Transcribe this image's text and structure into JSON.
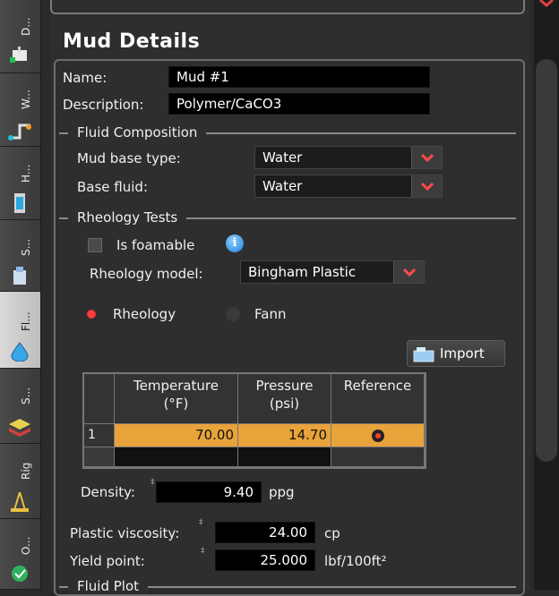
{
  "tabs": [
    {
      "label": "D...",
      "icon": "equipment-icon"
    },
    {
      "label": "W...",
      "icon": "wellbore-icon"
    },
    {
      "label": "H...",
      "icon": "hole-section-icon"
    },
    {
      "label": "S...",
      "icon": "string-icon"
    },
    {
      "label": "Fl...",
      "icon": "fluid-drop-icon"
    },
    {
      "label": "S...",
      "icon": "survey-icon"
    },
    {
      "label": "Rig",
      "icon": "rig-icon"
    },
    {
      "label": "O...",
      "icon": "operations-icon"
    }
  ],
  "title": "Mud Details",
  "name": {
    "label": "Name:",
    "value": "Mud #1"
  },
  "description": {
    "label": "Description:",
    "value": "Polymer/CaCO3"
  },
  "fluid_composition": {
    "title": "Fluid Composition",
    "mud_base_type": {
      "label": "Mud base type:",
      "value": "Water"
    },
    "base_fluid": {
      "label": "Base fluid:",
      "value": "Water"
    }
  },
  "rheology_tests": {
    "title": "Rheology Tests",
    "is_foamable": {
      "label": "Is foamable",
      "checked": false
    },
    "rheology_model": {
      "label": "Rheology model:",
      "value": "Bingham Plastic"
    },
    "radio_rheology": {
      "label": "Rheology",
      "selected": true
    },
    "radio_fann": {
      "label": "Fann",
      "selected": false
    },
    "import_label": "Import",
    "table": {
      "headers": [
        "Temperature (°F)",
        "Pressure (psi)",
        "Reference"
      ],
      "header_lines": [
        [
          "Temperature",
          "(°F)"
        ],
        [
          "Pressure",
          "(psi)"
        ],
        [
          "Reference"
        ]
      ],
      "rows": [
        {
          "index": "1",
          "temperature": "70.00",
          "pressure": "14.70",
          "reference": true
        }
      ]
    }
  },
  "density": {
    "label": "Density:",
    "value": "9.40",
    "unit": "ppg"
  },
  "plastic_viscosity": {
    "label": "Plastic viscosity:",
    "value": "24.00",
    "unit": "cp"
  },
  "yield_point": {
    "label": "Yield point:",
    "value": "25.000",
    "unit": "lbf/100ft²"
  },
  "fluid_plot": {
    "title": "Fluid Plot"
  },
  "colors": {
    "accent_row": "#e8a33a",
    "radio_on": "#ff3b3b",
    "arrow": "#ff4a4a"
  }
}
